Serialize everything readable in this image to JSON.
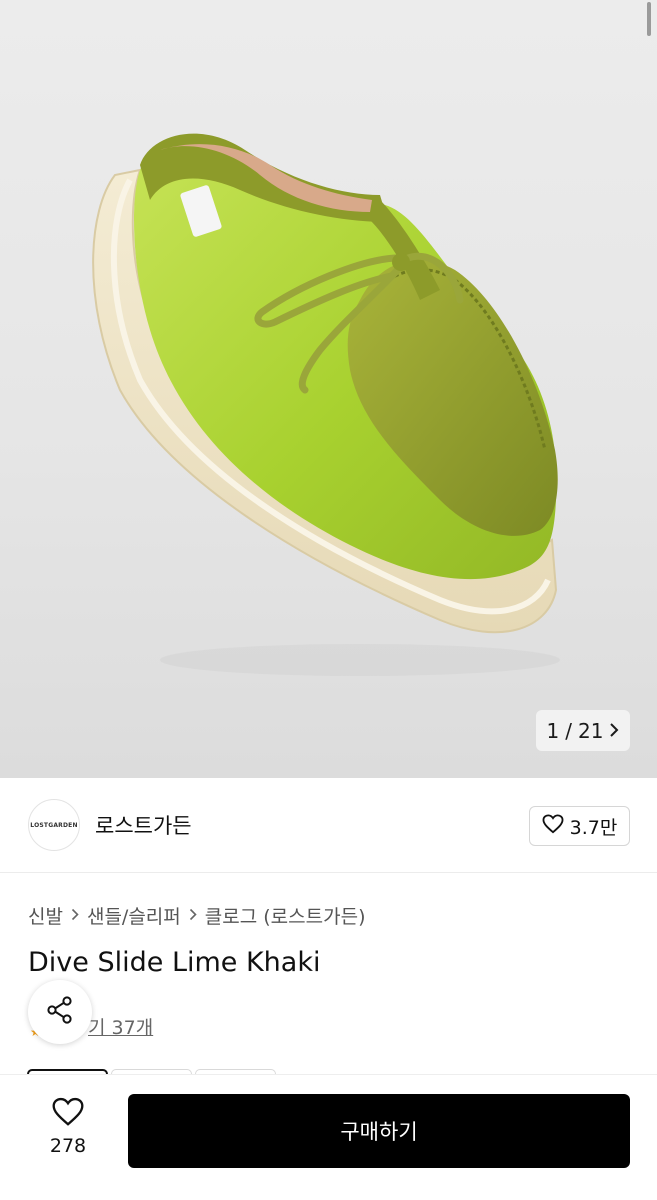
{
  "gallery": {
    "current": "1",
    "separator": "/",
    "total": "21",
    "next_icon": "chevron-right-icon"
  },
  "brand": {
    "logo_text": "LOSTGARDEN",
    "name": "로스트가든",
    "like_count": "3.7만",
    "like_icon": "heart-outline-icon"
  },
  "breadcrumb": {
    "items": [
      "신발",
      "샌들/슬리퍼",
      "클로그 (로스트가든)"
    ],
    "separator_icon": "chevron-right-icon"
  },
  "product": {
    "title": "Dive Slide Lime Khaki",
    "reviews_visible_text": "기 37개",
    "share_icon": "share-icon"
  },
  "bottom_bar": {
    "wish_count": "278",
    "wish_icon": "heart-outline-icon",
    "buy_label": "구매하기"
  },
  "colors": {
    "buy_button": "#000000",
    "rating_star": "#f3a019",
    "shoe_upper": "#a9d436",
    "shoe_khaki": "#8a9a2c",
    "sole": "#efe6cc"
  }
}
